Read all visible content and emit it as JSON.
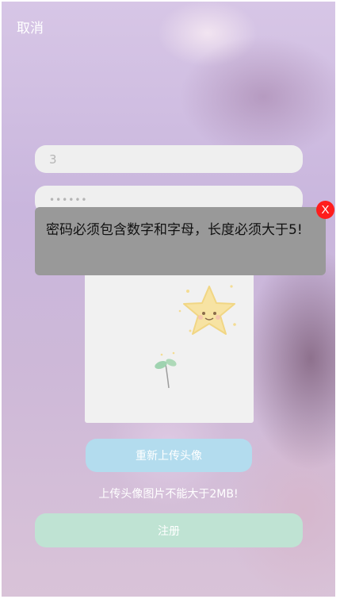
{
  "header": {
    "cancel_label": "取消"
  },
  "form": {
    "username_value": "3",
    "password_masked": "••••••"
  },
  "toast": {
    "message": "密码必须包含数字和字母，长度必须大于5!",
    "close_label": "X",
    "close_color": "#ff1d1d"
  },
  "avatar": {
    "reupload_label": "重新上传头像"
  },
  "hint": "上传头像图片不能大于2MB!",
  "register_label": "注册",
  "colors": {
    "reupload_bg": "#b3dcee",
    "register_bg": "#bfe3d3",
    "toast_bg": "#999999"
  }
}
